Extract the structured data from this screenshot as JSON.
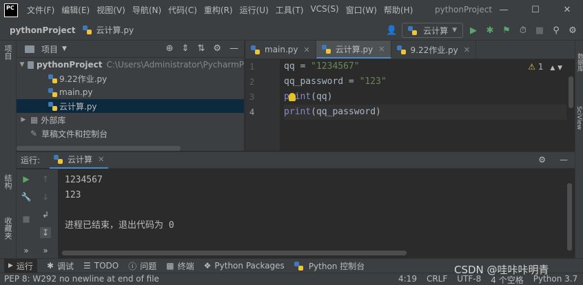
{
  "window": {
    "title": "pythonProject",
    "menu": [
      "文件(F)",
      "编辑(E)",
      "视图(V)",
      "导航(N)",
      "代码(C)",
      "重构(R)",
      "运行(U)",
      "工具(T)",
      "VCS(S)",
      "窗口(W)",
      "帮助(H)"
    ],
    "logo": "PC"
  },
  "navbar": {
    "project": "pythonProject",
    "file": "云计算.py",
    "run_config": "云计算"
  },
  "side_tabs": {
    "left_top": "项目",
    "left_bottom_1": "结构",
    "left_bottom_2": "收藏夹",
    "right_1": "数据库",
    "right_2": "SciView"
  },
  "project_panel": {
    "title": "项目",
    "root": "pythonProject",
    "root_path": "C:\\Users\\Administrator\\PycharmP",
    "files": [
      "9.22作业.py",
      "main.py",
      "云计算.py"
    ],
    "selected_file": "云计算.py",
    "ext_libs": "外部库",
    "scratches": "草稿文件和控制台"
  },
  "editor": {
    "tabs": [
      "main.py",
      "云计算.py",
      "9.22作业.py"
    ],
    "active_tab": "云计算.py",
    "line_numbers": [
      "1",
      "2",
      "3",
      "4"
    ],
    "warnings": "1",
    "code": {
      "l1_var": "qq",
      "l1_op": " = ",
      "l1_str": "\"1234567\"",
      "l2_var": "qq_password",
      "l2_op": " = ",
      "l2_str": "\"123\"",
      "l3_fn": "print",
      "l3_arg": "(qq)",
      "l4_fn": "print",
      "l4_arg": "(qq_password)"
    }
  },
  "run_panel": {
    "label": "运行:",
    "tab": "云计算",
    "output": [
      "1234567",
      "123",
      "",
      "进程已结束，退出代码为 0"
    ]
  },
  "bottom_tabs": [
    "运行",
    "调试",
    "TODO",
    "问题",
    "终端",
    "Python Packages",
    "Python 控制台"
  ],
  "status": {
    "message": "PEP 8: W292 no newline at end of file",
    "position": "4:19",
    "line_sep": "CRLF",
    "encoding": "UTF-8",
    "indent": "4 个空格",
    "interpreter": "Python 3.7"
  },
  "watermark": "CSDN @哇咔咔明青"
}
